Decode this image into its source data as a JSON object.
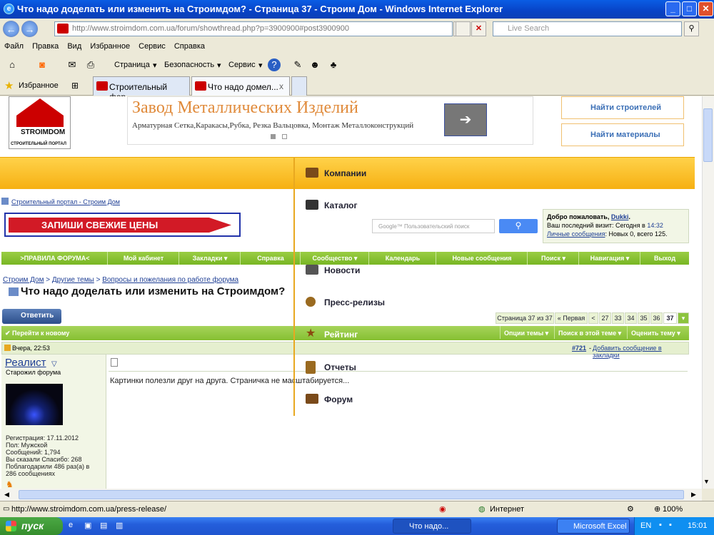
{
  "window": {
    "title": "Что надо доделать или изменить на Строимдом? - Страница 37 - Строим Дом - Windows Internet Explorer"
  },
  "address": {
    "url": "http://www.stroimdom.com.ua/forum/showthread.php?p=3900900#post3900900",
    "search_placeholder": "Live Search"
  },
  "menu": [
    "Файл",
    "Правка",
    "Вид",
    "Избранное",
    "Сервис",
    "Справка"
  ],
  "cmdbar": {
    "page": "Страница",
    "security": "Безопасность",
    "service": "Сервис"
  },
  "favbar": {
    "favorites": "Избранное",
    "tabs": [
      "Строительный фор...",
      "Что надо домел..."
    ],
    "tab_close": "x"
  },
  "site": {
    "logo_word": "STROIMDOM",
    "logo_sub": "СТРОИТЕЛЬНЫЙ ПОРТАЛ",
    "ad_title": "Завод Металлических Изделий",
    "ad_desc": "Арматурная Сетка,Каракасы,Рубка, Резка Вальцовка, Монтаж Металлоконструкций",
    "find_builders": "Найти строителей",
    "find_materials": "Найти материалы",
    "dropdown": [
      "Компании",
      "Каталог",
      "Новости",
      "Пресс-релизы",
      "Рейтинг",
      "Отчеты",
      "Форум"
    ],
    "crumb_top": "Строительный портал - Строим Дом",
    "banner": "ЗАПИШИ СВЕЖИЕ ЦЕНЫ",
    "google_placeholder": "Google™ Пользовательский поиск",
    "welcome": {
      "hello": "Добро пожаловать, ",
      "user": "Dukki",
      "visit": "Ваш последний визит: Сегодня в ",
      "time": "14:32",
      "pm": "Личные сообщения",
      "pm_rest": ": Новых 0, всего 125."
    },
    "nav": [
      ">ПРАВИЛА ФОРУМА<",
      "Мой кабинет",
      "Закладки ▾",
      "Справка",
      "Сообщество ▾",
      "Календарь",
      "Новые сообщения",
      "Поиск ▾",
      "Навигация ▾",
      "Выход"
    ],
    "crumb2": [
      "Строим Дом",
      "Другие темы",
      "Вопросы и пожелания по работе форума"
    ],
    "thread_title": "Что надо доделать или изменить на Строимдом?",
    "reply": "Ответить",
    "pager": {
      "info": "Страница 37 из 37",
      "first": "« Первая",
      "prev": "<",
      "pages": [
        "27",
        "33",
        "34",
        "35",
        "36",
        "37"
      ]
    },
    "gobar": {
      "go_new": "Перейти к новому",
      "opts": "Опции темы ▾",
      "search": "Поиск в этой теме ▾",
      "rate": "Оценить тему ▾"
    },
    "post": {
      "date": "Вчера, 22:53",
      "num": "#721",
      "bookmark": "Добавить сообщение в закладки",
      "user": "Реалист",
      "role": "Старожил форума",
      "stats": [
        "Регистрация: 17.11.2012",
        "Пол: Мужской",
        "Сообщений: 1,794",
        "Вы сказали Спасибо: 268",
        "Поблагодарили 486 раз(а) в",
        "286 сообщениях"
      ],
      "message": "Картинки полезли друг на друга. Страничка не масштабируется..."
    }
  },
  "status": {
    "url": "http://www.stroimdom.com.ua/press-release/",
    "zone": "Интернет",
    "zoom": "100%"
  },
  "taskbar": {
    "start": "пуск",
    "tasks": [
      "Что надо...",
      "Microsoft Excel"
    ],
    "lang": "EN",
    "clock": "15:01"
  }
}
